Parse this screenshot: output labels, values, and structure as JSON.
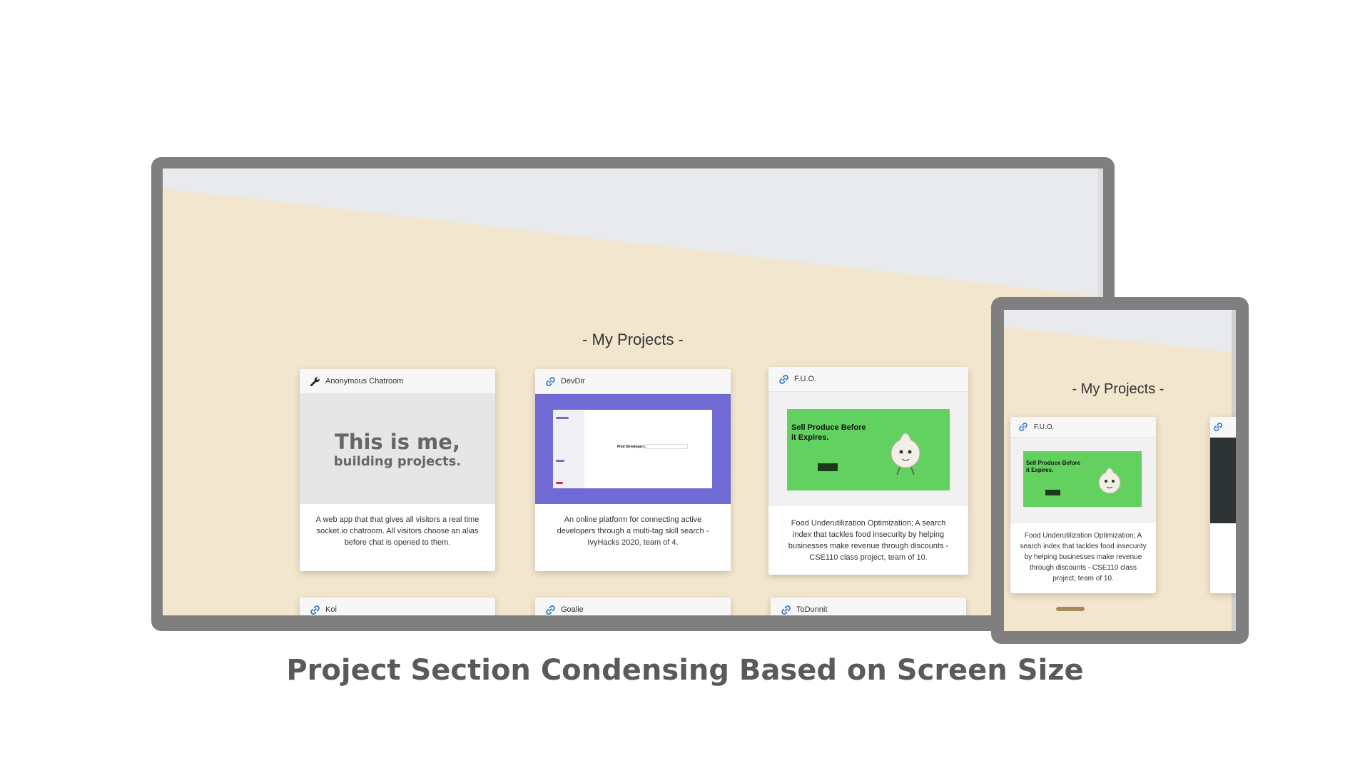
{
  "section_title": "- My Projects -",
  "caption": "Project Section Condensing Based on Screen Size",
  "desktop": {
    "cards": [
      {
        "title": "Anonymous Chatroom",
        "icon": "wrench-icon",
        "image_line1": "This is me,",
        "image_line2": "building projects.",
        "description": "A web app that that gives all visitors a real time socket.io chatroom. All visitors choose an alias before chat is opened to them."
      },
      {
        "title": "DevDir",
        "icon": "link-icon",
        "image_text": "Find Developers.",
        "description": "An online platform for connecting active developers through a multi-tag skill search - IvyHacks 2020, team of 4."
      },
      {
        "title": "F.U.O.",
        "icon": "link-icon",
        "image_text": "Sell Produce Before it Expires.",
        "description": "Food Underutilization Optimization; A search index that tackles food insecurity by helping businesses make revenue through discounts - CSE110 class project, team of 10."
      },
      {
        "title": "Koi",
        "icon": "link-icon"
      },
      {
        "title": "Goalie",
        "icon": "link-icon"
      },
      {
        "title": "ToDunnit",
        "icon": "link-icon"
      }
    ]
  },
  "tablet": {
    "card": {
      "title": "F.U.O.",
      "icon": "link-icon",
      "image_text": "Sell Produce Before it Expires.",
      "description": "Food Underutilization Optimization; A search index that tackles food insecurity by helping businesses make revenue through discounts - CSE110 class project, team of 10."
    }
  },
  "colors": {
    "accent_link": "#2a72c9",
    "fuo_green": "#63d160",
    "devdir_purple": "#6f6ad4",
    "frame_gray": "#7f7f7f",
    "page_bg": "#f3e6ce"
  }
}
